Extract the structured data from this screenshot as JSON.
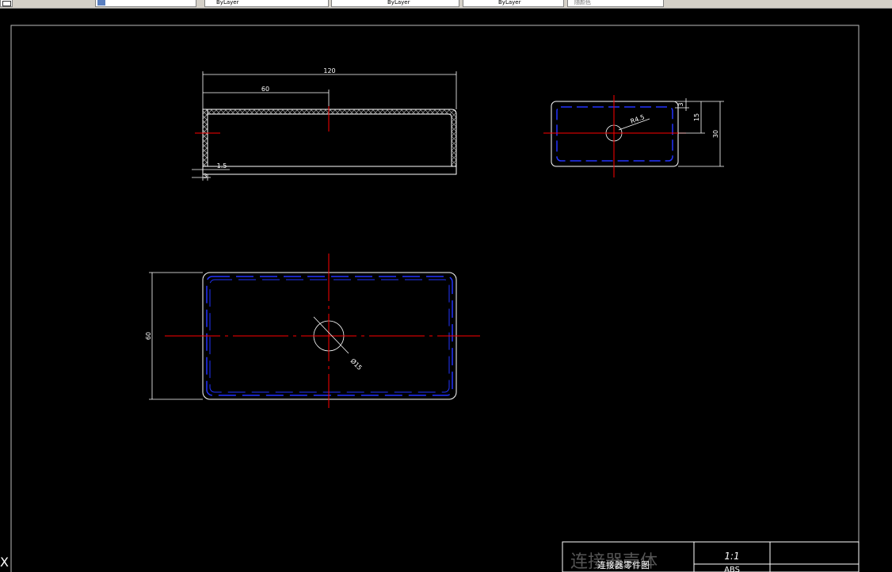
{
  "toolbar": {
    "items": [
      {
        "label": "",
        "icon": "app-menu-icon"
      },
      {
        "label": "",
        "icon": "layer-icon"
      },
      {
        "label": "ByLayer"
      },
      {
        "label": "ByLayer"
      },
      {
        "label": "ByLayer"
      },
      {
        "label": "随颜色"
      }
    ]
  },
  "views": {
    "front": {
      "dim_total": "120",
      "dim_half": "60",
      "dim_wall": "1.5",
      "dim_small": "3"
    },
    "side": {
      "radius": "R4.5",
      "dim_top": "3",
      "dim_mid": "15",
      "dim_height": "30"
    },
    "top": {
      "dim_width": "60",
      "dim_diameter": "Ø15"
    }
  },
  "title_block": {
    "part_name": "连接器壳体",
    "drawing_type": "连接器零件图",
    "scale": "1:1",
    "material": "ABS"
  },
  "colors": {
    "outline": "#ffffff",
    "centerline": "#ff0000",
    "hidden": "#0000ff",
    "hatch": "#808080"
  }
}
